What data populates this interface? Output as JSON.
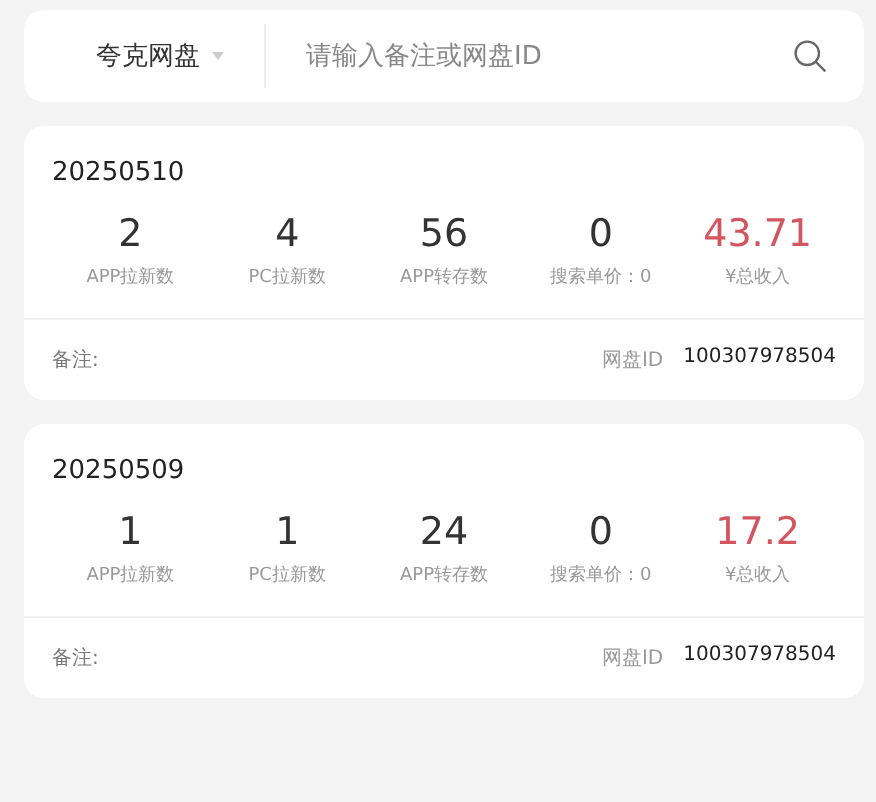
{
  "search": {
    "platform": "夸克网盘",
    "placeholder": "请输入备注或网盘ID"
  },
  "records": [
    {
      "date": "20250510",
      "stats": [
        {
          "kind": "plain",
          "value": "2",
          "label": "APP拉新数"
        },
        {
          "kind": "plain",
          "value": "4",
          "label": "PC拉新数"
        },
        {
          "kind": "plain",
          "value": "56",
          "label": "APP转存数"
        },
        {
          "kind": "plain",
          "value": "0",
          "label": "搜索单价：0"
        },
        {
          "kind": "income",
          "value": "43.71",
          "label": "¥总收入"
        }
      ],
      "note_label": "备注:",
      "id_label": "网盘ID",
      "id_value": "100307978504"
    },
    {
      "date": "20250509",
      "stats": [
        {
          "kind": "plain",
          "value": "1",
          "label": "APP拉新数"
        },
        {
          "kind": "plain",
          "value": "1",
          "label": "PC拉新数"
        },
        {
          "kind": "plain",
          "value": "24",
          "label": "APP转存数"
        },
        {
          "kind": "plain",
          "value": "0",
          "label": "搜索单价：0"
        },
        {
          "kind": "income",
          "value": "17.2",
          "label": "¥总收入"
        }
      ],
      "note_label": "备注:",
      "id_label": "网盘ID",
      "id_value": "100307978504"
    }
  ]
}
